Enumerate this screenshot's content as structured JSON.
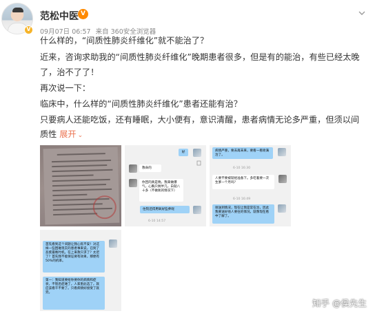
{
  "author": {
    "name": "范松中医"
  },
  "meta": {
    "date": "09月07日 06:57",
    "source": "来自 360安全浏览器"
  },
  "icons": {
    "verified": "verified-badge-icon",
    "vip": "vip-icon",
    "more": "chevron-down-icon",
    "expand": "expand-chevron-icon"
  },
  "colors": {
    "accent": "#eb7350",
    "text": "#333333",
    "meta": "#8a8a8a",
    "chat_blue": "#9fd2f7"
  },
  "content": {
    "lines": [
      "什么样的，“间质性肺炎纤维化”就不能治了？",
      "近来，咨询求助我的“间质性肺炎纤维化”晚期患者很多，但是有的能治，有些已经太晚",
      "了，治不了了！",
      "再次说一下：",
      "临床中，什么样的“间质性肺炎纤维化”患者还能有治？",
      "只要病人还能吃饭，还有睡眠，大小便有，意识清醒，患者病情无论多严重，但须以间",
      "质性"
    ],
    "expand_label": "展开"
  },
  "images": {
    "chat2": {
      "bubbles": [
        {
          "text": "好",
          "side": "right"
        },
        {
          "text": "救命的",
          "side": "left"
        },
        {
          "text": "你回的真是晚，我来做爆气，心胸只剩半几，白就八十多（不做氧的情况下）",
          "side": "left"
        },
        {
          "text": "住院还得用氧好些养呢",
          "side": "right"
        }
      ],
      "time": "6-10 14:57"
    },
    "chat3": {
      "bubbles": [
        {
          "text": "病情严重，要去再末来，要看一看喷满治了。",
          "side": "right"
        },
        {
          "text": "人要不要被就给准备下。多吃着要一次生爹一个月吗？",
          "side": "left"
        },
        {
          "text": "喷送到情况，现在让我是常在治，因此我要送好他人要往的情况，就像现在看中了解了。",
          "side": "right"
        }
      ],
      "times": [
        "6-10 16:30",
        "6-10 16:49"
      ]
    },
    "chat4": {
      "bubbles": [
        {
          "text": "首先看到这个间题让我心焦不安！对这样一些困难现实的患者事来说，已到了恶疾最晚时机。在上来救只求了？太迟了？首先我不能保证要有效果，那便有50%的机率。",
          "side": "right"
        },
        {
          "text": "第一：我知道要给你要你的病情和症状，不管后症难了。人家患此选了。就应该看干不要了。只看病情好接受了就完。",
          "side": "right"
        }
      ]
    }
  },
  "watermark": "知乎 @侯先生"
}
